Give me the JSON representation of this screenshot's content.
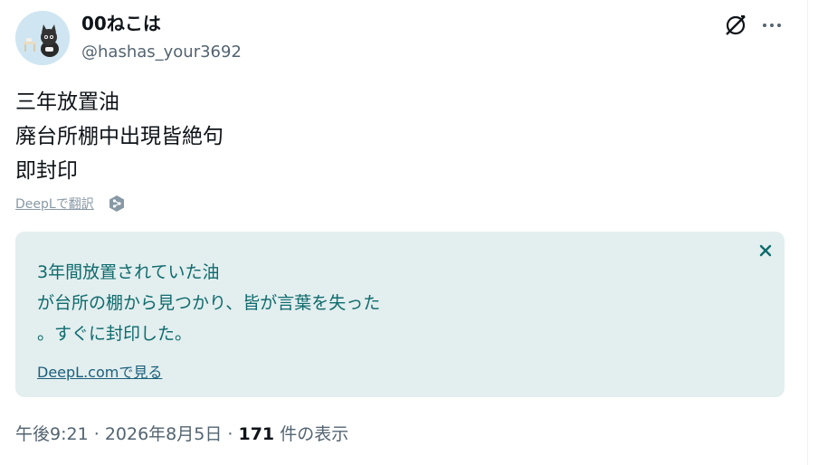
{
  "user": {
    "name": "00ねこは",
    "handle": "@hashas_your3692"
  },
  "tweet": {
    "lines": [
      "三年放置油",
      "廃台所棚中出現皆絶句",
      "即封印"
    ],
    "translate_link": "DeepLで翻訳"
  },
  "translation": {
    "lines": [
      "3年間放置されていた油",
      "が台所の棚から見つかり、皆が言葉を失った",
      "。すぐに封印した。"
    ],
    "link": "DeepL.comで見る"
  },
  "meta": {
    "time": "午後9:21",
    "separator": "·",
    "date": "2026年8月5日",
    "views_count": "171",
    "views_label": "件の表示"
  },
  "icons": {
    "header_right": [
      "grok-icon",
      "more-icon"
    ],
    "translate": "deepl-logo-icon",
    "close": "close-icon"
  },
  "colors": {
    "translation_bg": "#e3eeef",
    "translation_text": "#0f6b6d",
    "link": "#1a5f7a",
    "secondary_text": "#536471"
  }
}
